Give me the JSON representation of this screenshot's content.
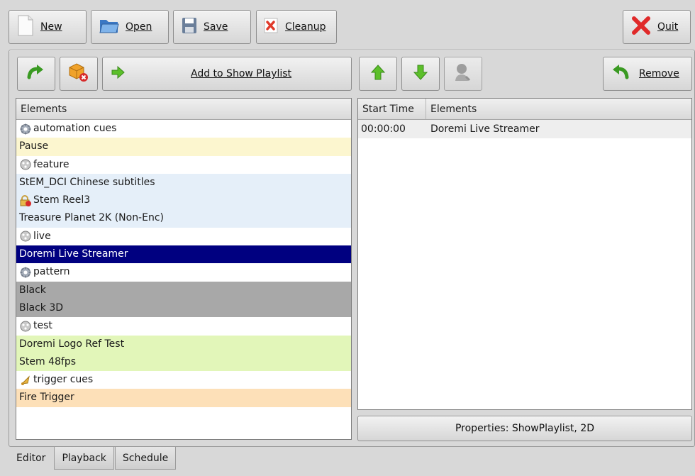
{
  "toolbar": {
    "new": "New",
    "open": "Open",
    "save": "Save",
    "cleanup": "Cleanup",
    "quit": "Quit"
  },
  "editor_toolbar": {
    "add_to_show_playlist": "Add to Show Playlist",
    "remove": "Remove"
  },
  "elements_list": {
    "header": "Elements",
    "items": [
      {
        "label": "automation cues",
        "icon": "gear-icon",
        "bg": "#ffffff",
        "fg": "#1a1a1a"
      },
      {
        "label": "Pause",
        "icon": "",
        "bg": "#fcf6cf",
        "fg": "#1a1a1a"
      },
      {
        "label": "feature",
        "icon": "film-reel-icon",
        "bg": "#ffffff",
        "fg": "#1a1a1a"
      },
      {
        "label": "StEM_DCI Chinese subtitles",
        "icon": "",
        "bg": "#e5eff9",
        "fg": "#1a1a1a"
      },
      {
        "label": "Stem Reel3",
        "icon": "lock-icon",
        "bg": "#e5eff9",
        "fg": "#1a1a1a"
      },
      {
        "label": "Treasure Planet 2K (Non-Enc)",
        "icon": "",
        "bg": "#e5eff9",
        "fg": "#1a1a1a"
      },
      {
        "label": "live",
        "icon": "film-reel-icon",
        "bg": "#ffffff",
        "fg": "#1a1a1a"
      },
      {
        "label": "Doremi Live Streamer",
        "icon": "",
        "bg": "#000080",
        "fg": "#ffffff"
      },
      {
        "label": "pattern",
        "icon": "gear-icon",
        "bg": "#ffffff",
        "fg": "#1a1a1a"
      },
      {
        "label": "Black",
        "icon": "",
        "bg": "#a8a8a8",
        "fg": "#1a1a1a"
      },
      {
        "label": "Black 3D",
        "icon": "",
        "bg": "#a8a8a8",
        "fg": "#1a1a1a"
      },
      {
        "label": "test",
        "icon": "film-reel-icon",
        "bg": "#ffffff",
        "fg": "#1a1a1a"
      },
      {
        "label": "Doremi Logo Ref Test",
        "icon": "",
        "bg": "#e2f6b9",
        "fg": "#1a1a1a"
      },
      {
        "label": "Stem 48fps",
        "icon": "",
        "bg": "#e2f6b9",
        "fg": "#1a1a1a"
      },
      {
        "label": "trigger cues",
        "icon": "bell-icon",
        "bg": "#ffffff",
        "fg": "#1a1a1a"
      },
      {
        "label": "Fire Trigger",
        "icon": "",
        "bg": "#fde0b8",
        "fg": "#1a1a1a"
      }
    ]
  },
  "playlist": {
    "col_start_time": "Start Time",
    "col_elements": "Elements",
    "rows": [
      {
        "start_time": "00:00:00",
        "element": "Doremi Live Streamer"
      }
    ]
  },
  "properties": "Properties: ShowPlaylist, 2D",
  "tabs": [
    "Editor",
    "Playback",
    "Schedule"
  ],
  "active_tab": "Editor"
}
